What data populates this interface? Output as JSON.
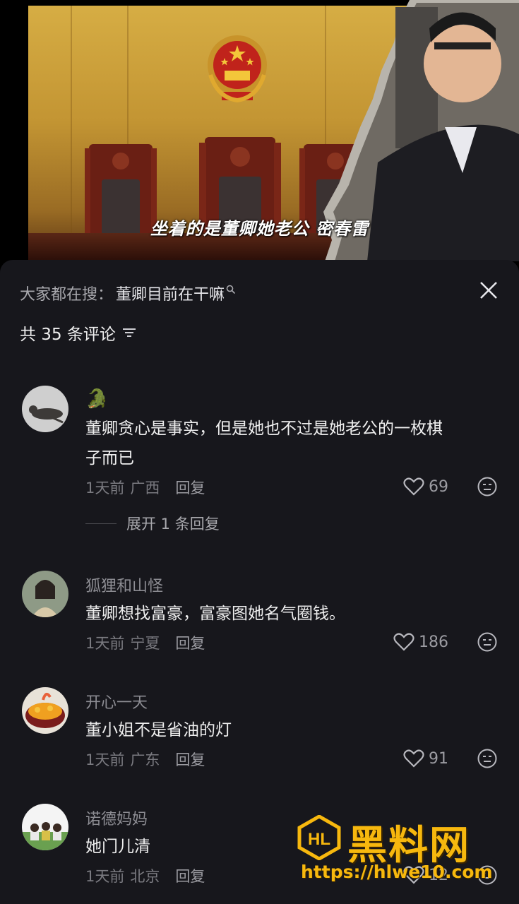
{
  "video": {
    "subtitle": "坐着的是董卿她老公 密春雷"
  },
  "sheet": {
    "search_prefix": "大家都在搜：",
    "search_keyword": "董卿目前在干嘛",
    "comment_count": "共 35 条评论"
  },
  "comments": [
    {
      "username": "",
      "username_emoji": "🐊",
      "text_line1": "董卿贪心是事实，但是她也不过是她老公的一枚棋",
      "text_line2": "子而已",
      "time": "1天前",
      "location": "广西",
      "reply": "回复",
      "likes": "69",
      "expand": "展开 1 条回复"
    },
    {
      "username": "狐狸和山怪",
      "text_line1": "董卿想找富豪，富豪图她名气圈钱。",
      "time": "1天前",
      "location": "宁夏",
      "reply": "回复",
      "likes": "186"
    },
    {
      "username": "开心一天",
      "text_line1": "董小姐不是省油的灯",
      "time": "1天前",
      "location": "广东",
      "reply": "回复",
      "likes": "91"
    },
    {
      "username": "诺德妈妈",
      "text_line1": "她门儿清",
      "time": "1天前",
      "location": "北京",
      "reply": "回复",
      "likes": "12"
    }
  ],
  "watermark": {
    "title": "黑料网",
    "url": "https://hlwe10.com"
  },
  "colors": {
    "sheet_bg": "#17171c",
    "watermark": "#f7b80e"
  }
}
